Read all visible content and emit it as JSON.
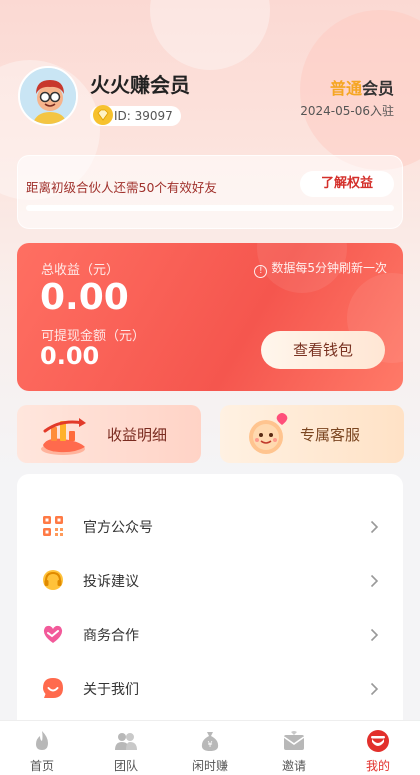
{
  "profile": {
    "username": "火火赚会员",
    "id_text": "ID: 39097",
    "level_name": "普通",
    "level_suffix": "会员",
    "join_date": "2024-05-06入驻"
  },
  "partner": {
    "message": "距离初级合伙人还需50个有效好友",
    "learn_button": "了解权益",
    "progress": 0
  },
  "earnings": {
    "total_label": "总收益（元）",
    "refresh_note": "数据每5分钟刷新一次",
    "total_value": "0.00",
    "withdraw_label": "可提现金额（元）",
    "withdraw_value": "0.00",
    "wallet_button": "查看钱包"
  },
  "quick_links": [
    {
      "label": "收益明细",
      "icon": "earnings-chart-icon"
    },
    {
      "label": "专属客服",
      "icon": "customer-service-mascot-icon"
    }
  ],
  "menu": [
    {
      "label": "官方公众号",
      "icon": "qr-code-icon"
    },
    {
      "label": "投诉建议",
      "icon": "headset-icon"
    },
    {
      "label": "商务合作",
      "icon": "handshake-heart-icon"
    },
    {
      "label": "关于我们",
      "icon": "smile-chat-icon"
    }
  ],
  "bottom_nav": [
    {
      "label": "首页",
      "icon": "home-flame-icon",
      "active": false
    },
    {
      "label": "团队",
      "icon": "team-icon",
      "active": false
    },
    {
      "label": "闲时赚",
      "icon": "money-bag-icon",
      "active": false
    },
    {
      "label": "邀请",
      "icon": "invite-mail-icon",
      "active": false
    },
    {
      "label": "我的",
      "icon": "profile-icon",
      "active": true
    }
  ],
  "colors": {
    "accent": "#e2302c",
    "card_red": "#f5564e",
    "level_gold": "#f5a623"
  }
}
